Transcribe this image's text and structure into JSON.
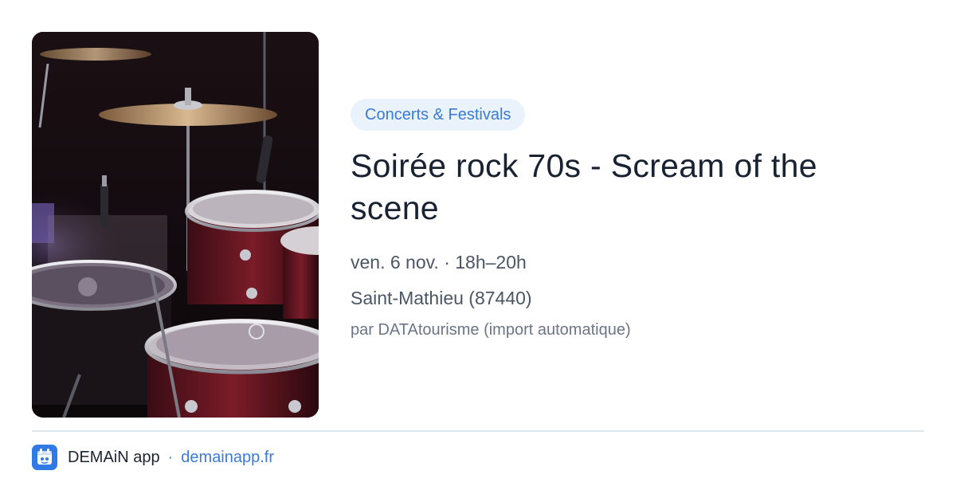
{
  "event": {
    "image_alt": "drum kit on stage",
    "category": "Concerts & Festivals",
    "title": "Soirée rock 70s - Scream of the scene",
    "datetime": "ven. 6 nov. · 18h–20h",
    "location": "Saint-Mathieu (87440)",
    "source": "par DATAtourisme (import automatique)"
  },
  "footer": {
    "logo_icon": "demain-app-logo-icon",
    "app_name": "DEMAiN app",
    "separator": "·",
    "link": "demainapp.fr"
  },
  "colors": {
    "accent": "#3a7bd5",
    "chip_bg": "#eaf2fc",
    "title": "#182232",
    "muted": "#4a5566",
    "logo_bg": "#2f7ae5"
  }
}
